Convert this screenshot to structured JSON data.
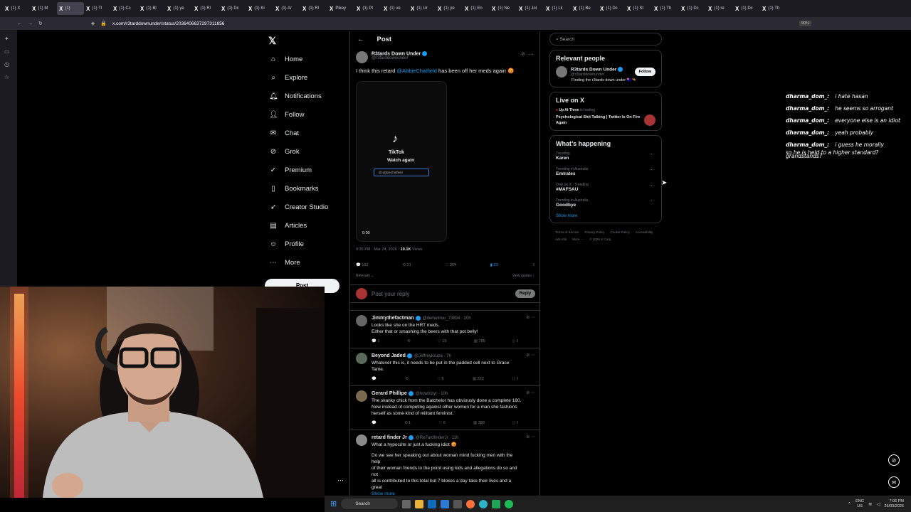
{
  "browser": {
    "tabs": [
      "(1) X",
      "(1) M",
      "(1)",
      "(1) Tl",
      "(1) Cc",
      "(1) Bl",
      "(1) ye",
      "(1) Rl",
      "(1) Dc",
      "(1) Ki",
      "(1) Ar",
      "(1) Rl",
      "Pikey",
      "(1) Pt",
      "(1) ve",
      "(1) Ur",
      "(1) ye",
      "(1) En",
      "(1) Ne",
      "(1) Jol",
      "(1) Lil",
      "(1) Be",
      "(1) Dc",
      "(1) St",
      "(1) Th",
      "(1) Dc",
      "(1) re",
      "(1) Dc",
      "(1) Th"
    ],
    "url": "x.com/r3tarddownunder/status/2036406637297311856",
    "zoom": "90%"
  },
  "nav": {
    "items": [
      {
        "icon": "home-icon",
        "label": "Home"
      },
      {
        "icon": "search-icon",
        "label": "Explore"
      },
      {
        "icon": "bell-icon",
        "label": "Notifications"
      },
      {
        "icon": "follow-icon",
        "label": "Follow"
      },
      {
        "icon": "mail-icon",
        "label": "Chat"
      },
      {
        "icon": "grok-icon",
        "label": "Grok"
      },
      {
        "icon": "premium-icon",
        "label": "Premium"
      },
      {
        "icon": "bookmark-icon",
        "label": "Bookmarks"
      },
      {
        "icon": "rocket-icon",
        "label": "Creator Studio"
      },
      {
        "icon": "articles-icon",
        "label": "Articles"
      },
      {
        "icon": "profile-icon",
        "label": "Profile"
      },
      {
        "icon": "more-icon",
        "label": "More"
      }
    ],
    "post_label": "Post"
  },
  "post": {
    "header": "Post",
    "author": "R3tards Down Under",
    "handle": "@r3tarddownunder",
    "text_before": "I think this retard ",
    "mention": "@AbbieChatfield",
    "text_after": " has been off her meds again 😡",
    "video": {
      "brand": "TikTok",
      "watch_again": "Watch again",
      "handle": "@ abbiechatfield",
      "time": "0:00"
    },
    "meta_time": "9:35 PM · Mar 24, 2026 · ",
    "views": "19.1K",
    "views_label": " Views",
    "stats": {
      "replies": "162",
      "reposts": "21",
      "likes": "364",
      "bookmarks": "23"
    },
    "relevant": "Relevant",
    "view_quotes": "View quotes",
    "reply_placeholder": "Post your reply",
    "reply_button": "Reply"
  },
  "replies": [
    {
      "name": "Jimmythefactman",
      "handle": "@demetriou_73894 · 20h",
      "lines": [
        "Looks like she on the HRT meds.",
        "Either that or smashing the beers with that pot belly!"
      ],
      "stats": [
        "1",
        "",
        "15",
        "785"
      ]
    },
    {
      "name": "Beyond Jaded",
      "handle": "@JeffreyKrupa · 7h",
      "lines": [
        "Whatever this is, it needs to be put in the padded cell next to Grace Tame."
      ],
      "stats": [
        "",
        "",
        "5",
        "222"
      ]
    },
    {
      "name": "Gerard Phillipe",
      "handle": "@howInzyr · 10h",
      "lines": [
        "The skanky chick from the Batchelor has obviously done a complete 180.",
        "Now instead of competing against other women for a man she fashions",
        "herself as some kind of militant feminist."
      ],
      "stats": [
        "",
        "1",
        "6",
        "388"
      ]
    },
    {
      "name": "retard finder Jr",
      "handle": "@Re7ardfinderJr · 11h",
      "lines": [
        "What a hypocrite or just a fucking idiot 😡",
        "",
        "Do we see her speaking out about woman mind fucking men  with the help",
        "of their woman friends to the point using kids and allegations do so and not",
        "all is contributed to this total but 7 blokes a day take their lives and a great"
      ],
      "more": "Show more",
      "stats": [
        "",
        "1",
        "8",
        "425"
      ]
    }
  ],
  "sidebar": {
    "search_placeholder": "Search",
    "relevant_title": "Relevant people",
    "person": {
      "name": "R3tards Down Under",
      "handle": "@r3tarddownunder",
      "bio": "Finding the r3tards down under 🇦🇺🦘",
      "follow": "Follow"
    },
    "live_title": "Live on X",
    "live": {
      "host": "Up At Three",
      "hosting": "is hosting",
      "title": "Psychological Shit Talking | Twitter Is On Fire Again"
    },
    "happening_title": "What’s happening",
    "trends": [
      {
        "context": "Trending",
        "name": "Karen"
      },
      {
        "context": "Trending in Australia",
        "name": "Emirates"
      },
      {
        "context": "Only on X · Trending",
        "name": "#MAFSAU"
      },
      {
        "context": "Trending in Australia",
        "name": "Goodbye"
      }
    ],
    "show_more": "Show more",
    "footer": [
      "Terms of Service",
      "Privacy Policy",
      "Cookie Policy",
      "Accessibility",
      "Ads info",
      "More ···",
      "© 2026 X Corp."
    ]
  },
  "chat": [
    {
      "user": "dharma_dom_:",
      "msg": "i hate hasan"
    },
    {
      "user": "dharma_dom_:",
      "msg": "he seems so arrogant"
    },
    {
      "user": "dharma_dom_:",
      "msg": "everyone else is an idiot"
    },
    {
      "user": "dharma_dom_:",
      "msg": "yeah probably"
    },
    {
      "user": "dharma_dom_:",
      "msg": "i guess he morally grandstands?"
    },
    {
      "user": "",
      "msg": "so he is held to a higher standard?"
    }
  ],
  "taskbar": {
    "search": "Search",
    "lang": "ENG",
    "region": "US",
    "time": "7:06 PM",
    "date": "25/03/2026"
  },
  "colors": {
    "accent": "#1d9bf0",
    "bg": "#000000",
    "border": "#2f3336",
    "muted": "#71767b"
  }
}
